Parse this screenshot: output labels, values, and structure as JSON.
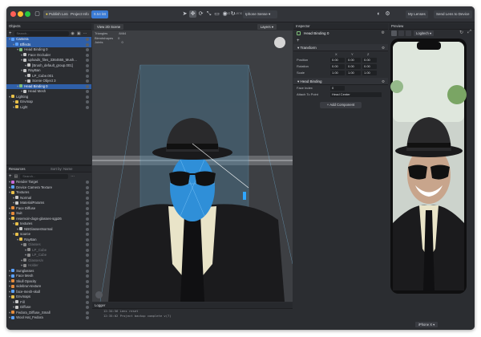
{
  "window": {
    "title": "test – Lens Studio"
  },
  "toolbar": {
    "pill_publish": "Publish Lens",
    "pill_project_info": "Project Info",
    "pill_size": "9.54 kB",
    "device_dropdown": "Iphone Sense ▾",
    "my_lenses": "My Lenses",
    "send_to_device": "Send Lens to Device"
  },
  "objects": {
    "header": "Objects",
    "search_placeholder": "Search...",
    "items": [
      {
        "label": "Camera",
        "depth": 0,
        "color": "#5aa1ff",
        "selected": true
      },
      {
        "label": "Effects",
        "depth": 1,
        "color": "#5aa1ff",
        "selected": true
      },
      {
        "label": "Head Binding 0",
        "depth": 2,
        "color": "#7fc07a"
      },
      {
        "label": "Face Occluder",
        "depth": 3,
        "color": "#c8c8c8"
      },
      {
        "label": "uploads_files_3364555_Mush...",
        "depth": 3,
        "color": "#c8c8c8"
      },
      {
        "label": "[Brush_default_group.001]",
        "depth": 4,
        "color": "#c8c8c8"
      },
      {
        "label": "RayBan",
        "depth": 3,
        "color": "#c8c8c8"
      },
      {
        "label": "LP_Cube.001",
        "depth": 4,
        "color": "#c8c8c8"
      },
      {
        "label": "Scene Object 3",
        "depth": 4,
        "color": "#c8c8c8"
      },
      {
        "label": "Head Binding 0",
        "depth": 2,
        "color": "#7fc07a",
        "selected": true
      },
      {
        "label": "Head Mesh",
        "depth": 3,
        "color": "#c8c8c8"
      },
      {
        "label": "Lighting",
        "depth": 0,
        "color": "#e8c04a"
      },
      {
        "label": "Envmap",
        "depth": 1,
        "color": "#e8c04a"
      },
      {
        "label": "Light",
        "depth": 1,
        "color": "#e8c04a"
      }
    ]
  },
  "resources": {
    "header": "Resources",
    "sort_label": "Sort by: Name",
    "search_placeholder": "Search...",
    "items": [
      {
        "label": "Render Target",
        "depth": 0,
        "color": "#c86ad8"
      },
      {
        "label": "Device Camera Texture",
        "depth": 0,
        "color": "#5aa1ff"
      },
      {
        "label": "Textures",
        "depth": 0,
        "color": "#e8c04a"
      },
      {
        "label": "Normal",
        "depth": 1,
        "color": "#c8c8c8"
      },
      {
        "label": "MaterialParams",
        "depth": 1,
        "color": "#c8c8c8"
      },
      {
        "label": "Face Diffuse",
        "depth": 0,
        "color": "#e58b3b"
      },
      {
        "label": "Suit",
        "depth": 0,
        "color": "#e58b3b"
      },
      {
        "label": "reservoir-dogs-glasses-sgp26",
        "depth": 0,
        "color": "#e8c04a"
      },
      {
        "label": "textures",
        "depth": 1,
        "color": "#e8c04a"
      },
      {
        "label": "NBGlassesNormal",
        "depth": 2,
        "color": "#c8c8c8"
      },
      {
        "label": "source",
        "depth": 1,
        "color": "#e8c04a"
      },
      {
        "label": "RayBan",
        "depth": 2,
        "color": "#e8c04a"
      },
      {
        "label": "Glasses",
        "depth": 3,
        "color": "#888",
        "dim": true
      },
      {
        "label": "LP_Cube",
        "depth": 4,
        "color": "#888",
        "dim": true
      },
      {
        "label": "LP_Cube",
        "depth": 4,
        "color": "#888",
        "dim": true
      },
      {
        "label": "Glasses/v",
        "depth": 3,
        "color": "#888",
        "dim": true
      },
      {
        "label": "Holder",
        "depth": 3,
        "color": "#888",
        "dim": true
      },
      {
        "label": "Sunglasses",
        "depth": 0,
        "color": "#5aa1ff"
      },
      {
        "label": "Face Mesh",
        "depth": 0,
        "color": "#5aa1ff"
      },
      {
        "label": "Skull Opacity",
        "depth": 0,
        "color": "#e58b3b"
      },
      {
        "label": "sidebrun-texture",
        "depth": 0,
        "color": "#e58b3b"
      },
      {
        "label": "face-mesh-skull",
        "depth": 0,
        "color": "#5aa1ff"
      },
      {
        "label": "Envmaps",
        "depth": 0,
        "color": "#e8c04a"
      },
      {
        "label": "Fill",
        "depth": 1,
        "color": "#c8c8c8"
      },
      {
        "label": "Diffuse",
        "depth": 1,
        "color": "#c8c8c8"
      },
      {
        "label": "Fedora_Diffuse_Small",
        "depth": 0,
        "color": "#e58b3b"
      },
      {
        "label": "Wool Hat_Fedora",
        "depth": 0,
        "color": "#5aa1ff"
      }
    ]
  },
  "scene": {
    "tab": "View 2D Scene",
    "layers_button": "Layers ▾",
    "stats": [
      {
        "label": "Triangles",
        "value": "8464"
      },
      {
        "label": "Blendshapes",
        "value": "0"
      },
      {
        "label": "Joints",
        "value": "0"
      }
    ]
  },
  "logger": {
    "header": "Logger",
    "lines": [
      "12:34:56   Lens reset",
      "12:35:02   Project backup complete v(7)"
    ]
  },
  "inspector": {
    "header": "Inspector",
    "object_name": "Head Binding 0",
    "transform": {
      "title": "Transform",
      "axes": [
        "X",
        "Y",
        "Z"
      ],
      "rows": [
        {
          "label": "Position",
          "values": [
            "0.00",
            "0.00",
            "0.00"
          ]
        },
        {
          "label": "Rotation",
          "values": [
            "0.00",
            "0.00",
            "0.00"
          ]
        },
        {
          "label": "Scale",
          "values": [
            "1.00",
            "1.00",
            "1.00"
          ]
        }
      ]
    },
    "head_binding": {
      "title": "Head Binding",
      "face_index_label": "Face Index",
      "face_index_value": "0",
      "attach_label": "Attach To Point",
      "attach_value": "Head Center"
    },
    "add_component": "+ Add Component"
  },
  "preview": {
    "header": "Preview",
    "mode": "Logitech ▾",
    "device": "iPhone X ▾"
  }
}
